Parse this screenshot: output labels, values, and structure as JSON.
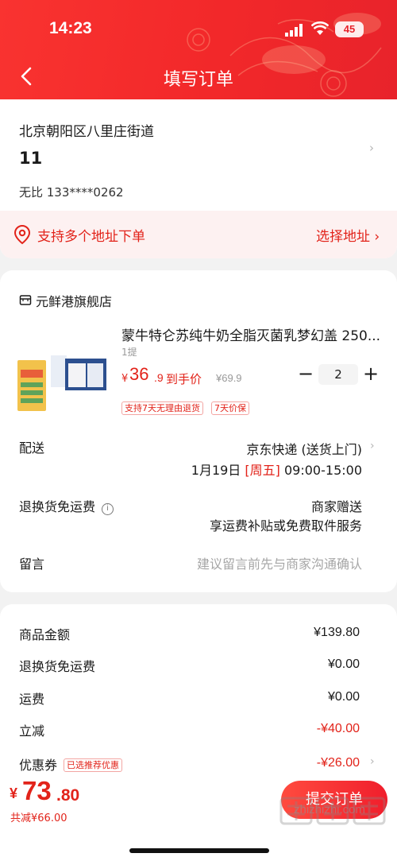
{
  "status_bar": {
    "time": "14:23",
    "battery": "45"
  },
  "nav": {
    "title": "填写订单"
  },
  "address": {
    "line": "北京朝阳区八里庄街道",
    "name": "11",
    "contact": "无比  133****0262",
    "multi_text": "支持多个地址下单",
    "select_label": "选择地址 ›"
  },
  "shop": {
    "name": "元鲜港旗舰店"
  },
  "product": {
    "title": "蒙牛特仑苏纯牛奶全脂灭菌乳梦幻盖 250...",
    "spec": "1提",
    "price_symbol": "¥",
    "price_int": "36",
    "price_dec": ".9",
    "price_label": "到手价",
    "original_price": "¥69.9",
    "quantity": "2",
    "minus": "−",
    "plus": "+",
    "tags": [
      "支持7天无理由退货",
      "7天价保"
    ]
  },
  "delivery": {
    "label": "配送",
    "carrier": "京东快递 (送货上门)",
    "date": "1月19日",
    "weekday": "[周五]",
    "time": "09:00-15:00"
  },
  "return_shipping": {
    "label": "退换货免运费",
    "info_icon": "i",
    "value_line1": "商家赠送",
    "value_line2": "享运费补贴或免费取件服务"
  },
  "remark": {
    "label": "留言",
    "placeholder": "建议留言前先与商家沟通确认"
  },
  "summary": {
    "items": [
      {
        "label": "商品金额",
        "value": "¥139.80"
      },
      {
        "label": "退换货免运费",
        "value": "¥0.00"
      },
      {
        "label": "运费",
        "value": "¥0.00"
      },
      {
        "label": "立减",
        "value": "-¥40.00"
      },
      {
        "label": "优惠券",
        "value": "-¥26.00",
        "tag": "已选推荐优惠"
      }
    ]
  },
  "bottom": {
    "total_symbol": "¥",
    "total_int": "73",
    "total_dec": ".80",
    "saved": "共减¥66.00",
    "submit_label": "提交订单",
    "watermark": "zhizhizhi.com"
  },
  "colors": {
    "brand_red": "#e2231a",
    "header_red": "#f2282a"
  }
}
